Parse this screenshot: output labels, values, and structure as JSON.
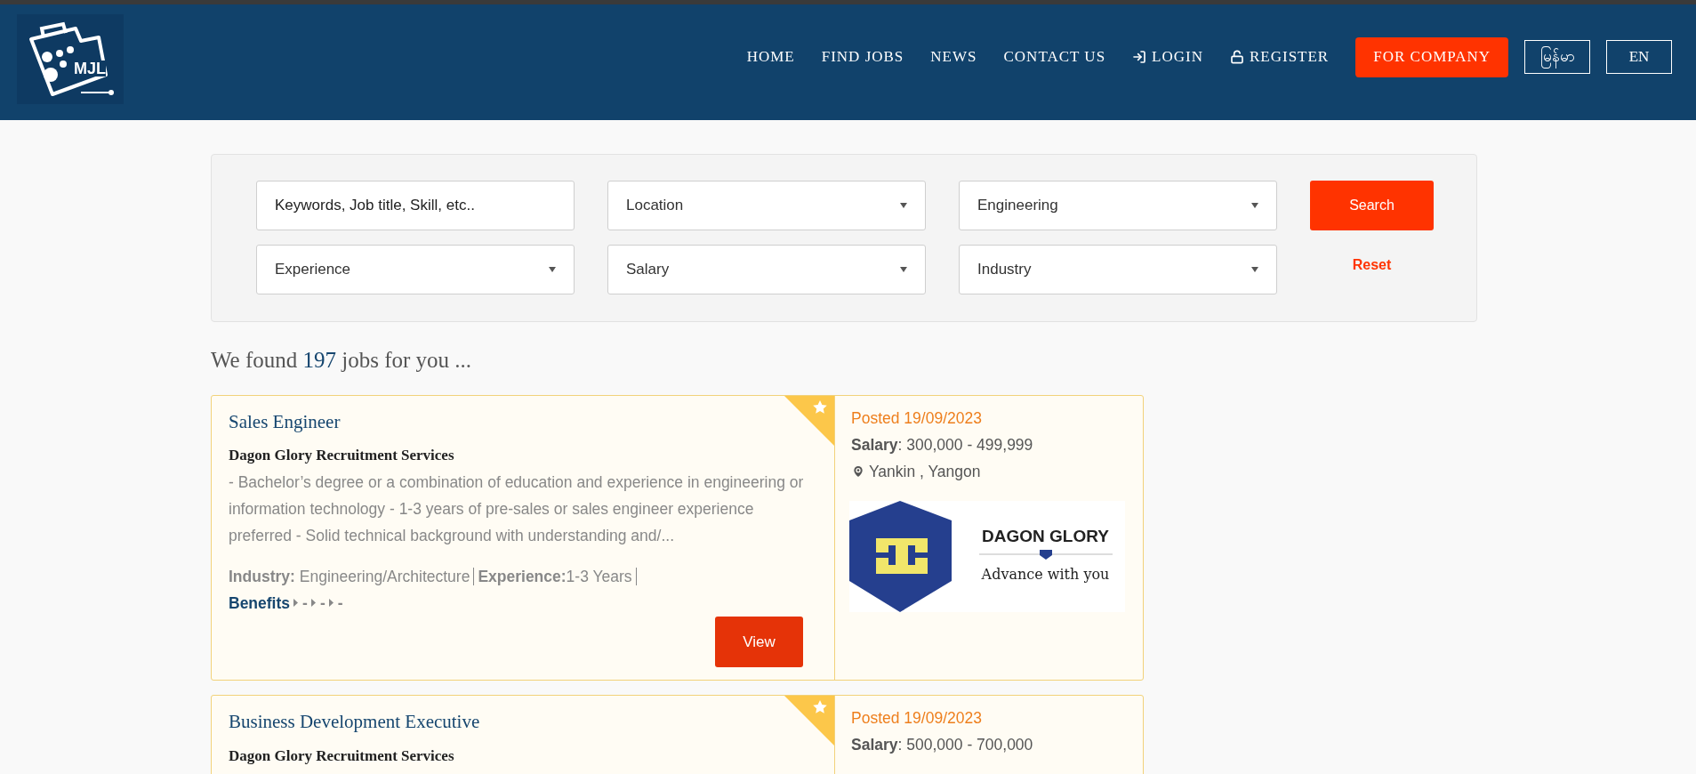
{
  "header": {
    "logo_text": "MJL",
    "nav": [
      {
        "label": "HOME",
        "kind": "plain"
      },
      {
        "label": "FIND JOBS",
        "kind": "plain"
      },
      {
        "label": "NEWS",
        "kind": "plain"
      },
      {
        "label": "CONTACT US",
        "kind": "plain"
      },
      {
        "label": "LOGIN",
        "kind": "login"
      },
      {
        "label": "REGISTER",
        "kind": "register"
      }
    ],
    "company_button": "FOR COMPANY",
    "languages": [
      {
        "label": "မြန်မာ"
      },
      {
        "label": "EN"
      }
    ]
  },
  "search": {
    "fields": [
      {
        "kind": "text",
        "placeholder": "Keywords, Job title, Skill, etc.."
      },
      {
        "kind": "select",
        "value": "Location"
      },
      {
        "kind": "select",
        "value": "Engineering"
      },
      {
        "kind": "select",
        "value": "Experience"
      },
      {
        "kind": "select",
        "value": "Salary"
      },
      {
        "kind": "select",
        "value": "Industry"
      }
    ],
    "search_button": "Search",
    "reset_link": "Reset"
  },
  "results": {
    "prefix": "We found",
    "count": "197",
    "suffix": "jobs for you ..."
  },
  "jobs": [
    {
      "title": "Sales Engineer",
      "featured": true,
      "company": "Dagon Glory Recruitment Services",
      "description": "- Bachelor’s degree or a combination of education and experience in engineering or information technology - 1-3 years of pre-sales or sales engineer experience preferred - Solid technical background with understanding and/...",
      "industry_label": "Industry:",
      "industry": "Engineering/Architecture",
      "experience_label": "Experience:",
      "experience": "1-3 Years",
      "benefits_label": "Benefits",
      "benefits": [
        "-",
        "-",
        "-"
      ],
      "view_button": "View",
      "posted": "Posted 19/09/2023",
      "salary_label": "Salary",
      "salary": ": 300,000 - 499,999",
      "location": "Yankin , Yangon",
      "logo": {
        "name": "DAGON GLORY",
        "tagline": "Advance with you"
      }
    },
    {
      "title": "Business Development Executive",
      "featured": true,
      "company": "Dagon Glory Recruitment Services",
      "posted": "Posted 19/09/2023",
      "salary_label": "Salary",
      "salary": ": 500,000 - 700,000"
    }
  ]
}
